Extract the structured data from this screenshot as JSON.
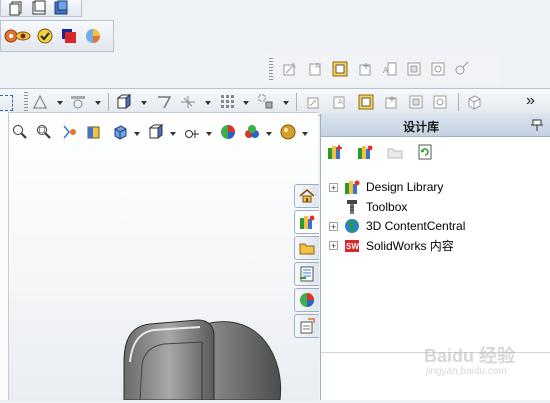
{
  "taskpane": {
    "title": "设计库",
    "tree": [
      {
        "label": "Design Library",
        "icon": "design-library-icon",
        "expandable": true
      },
      {
        "label": "Toolbox",
        "icon": "toolbox-icon",
        "expandable": false
      },
      {
        "label": "3D ContentCentral",
        "icon": "globe-icon",
        "expandable": true
      },
      {
        "label": "SolidWorks 内容",
        "icon": "solidworks-content-icon",
        "expandable": true
      }
    ]
  },
  "toolbar": {
    "overflow_label": "»"
  },
  "watermark": {
    "text": "Baidu 经验",
    "url": "jingyan.baidu.com"
  },
  "colors": {
    "panel_header": "#c4d1e1",
    "viewport_bg": "#ffffff",
    "toolbar_bg": "#e2e7ee"
  }
}
